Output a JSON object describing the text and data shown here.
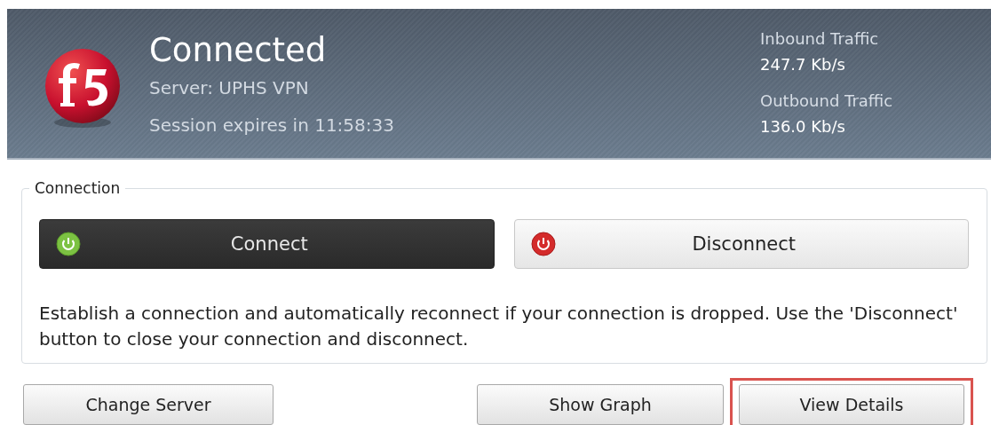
{
  "status": {
    "title": "Connected",
    "server": "Server: UPHS VPN",
    "session": "Session expires in 11:58:33"
  },
  "traffic": [
    {
      "label": "Inbound Traffic",
      "value": "247.7 Kb/s"
    },
    {
      "label": "Outbound Traffic",
      "value": "136.0 Kb/s"
    }
  ],
  "connection": {
    "legend": "Connection",
    "modes": [
      {
        "label": "Connect",
        "kind": "connect",
        "selected": true
      },
      {
        "label": "Disconnect",
        "kind": "disconnect",
        "selected": false
      }
    ],
    "description": "Establish a connection and automatically reconnect if your connection is dropped. Use the 'Disconnect' button to close your connection and disconnect."
  },
  "buttons": [
    {
      "label": "Change Server",
      "highlighted": false
    },
    {
      "label": "Show Graph",
      "highlighted": false
    },
    {
      "label": "View Details",
      "highlighted": true
    }
  ]
}
